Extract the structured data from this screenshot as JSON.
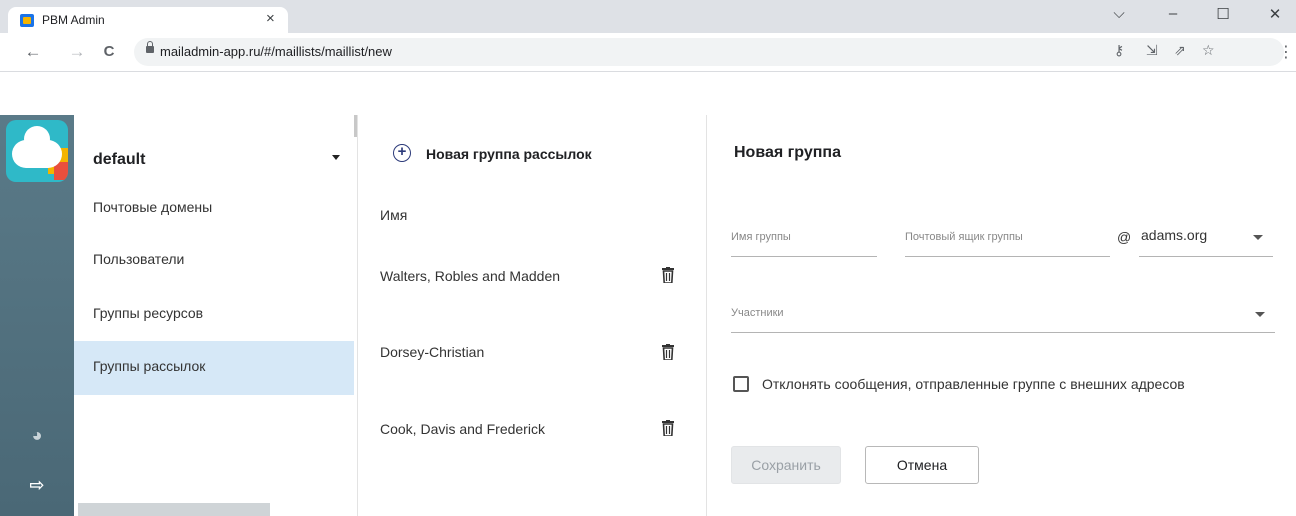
{
  "browser": {
    "tab_title": "PBM Admin",
    "tab_close": "×",
    "url": "mailadmin-app.ru/#/maillists/maillist/new",
    "window_controls": {
      "dropdown": "⌵",
      "minimize": "–",
      "maximize": "☐",
      "close": "✕"
    },
    "nav": {
      "back": "←",
      "forward": "→",
      "reload": "C"
    },
    "omnibox_icons": [
      "key-icon",
      "install-icon",
      "share-icon",
      "star-icon"
    ],
    "menu": "⋮"
  },
  "sidebar": {
    "domain": "default",
    "items": [
      {
        "label": "Почтовые домены"
      },
      {
        "label": "Пользователи"
      },
      {
        "label": "Группы ресурсов"
      },
      {
        "label": "Группы рассылок"
      }
    ],
    "active_index": 3
  },
  "list": {
    "new_group": "Новая группа рассылок",
    "column_name": "Имя",
    "rows": [
      {
        "name": "Walters, Robles and Madden"
      },
      {
        "name": "Dorsey-Christian"
      },
      {
        "name": "Cook, Davis and Frederick"
      }
    ]
  },
  "form": {
    "title": "Новая группа",
    "group_name_placeholder": "Имя группы",
    "mailbox_placeholder": "Почтовый ящик группы",
    "at": "@",
    "domain": "adams.org",
    "members_placeholder": "Участники",
    "reject_external_label": "Отклонять сообщения, отправленные группе с внешних адресов",
    "reject_external_checked": false,
    "save_label": "Сохранить",
    "cancel_label": "Отмена"
  },
  "colors": {
    "rail": "#4e6b78",
    "active_item": "#d6e8f7",
    "accent": "#2c3a7a"
  }
}
